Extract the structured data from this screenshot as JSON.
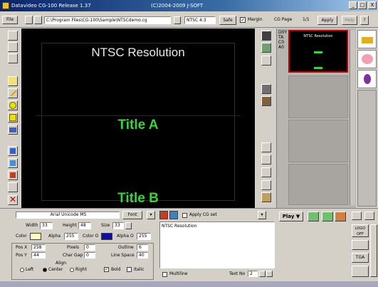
{
  "window": {
    "title": "Datavideo CG-100 Release 1.37",
    "copyright": "(C)2004-2009 J-SOFT",
    "minimize": "_",
    "maximize": "□",
    "close": "X"
  },
  "toolbar": {
    "file_label": "File",
    "path": "C:\\Program Files\\CG-100\\Sample\\NTSCdemo.cg",
    "format": "NTSC 4:3",
    "safe_label": "Safe",
    "margin_label": "Margin",
    "cg_page_label": "CG Page",
    "page_count": "1/1",
    "apply_label": "Apply",
    "help_label": "Help"
  },
  "preview": {
    "line1": "NTSC Resolution",
    "line2": "Title A",
    "line3": "Title B"
  },
  "pages": [
    {
      "label": "NTSC Resolution",
      "selected": true
    }
  ],
  "side_labels": [
    "D0Y",
    "TA",
    "C0",
    "A0"
  ],
  "bottom": {
    "font_name": "Arial Unicode MS",
    "font_btn": "Font",
    "width_label": "Width",
    "width_val": "33",
    "height_label": "Height",
    "height_val": "48",
    "size_label": "Size",
    "size_val": "33",
    "color_label": "Color",
    "alpha_label": "Alpha",
    "alpha_val": "255",
    "color2_label": "Color O",
    "alpha2_label": "Alpha O",
    "alpha2_val": "255",
    "posx_label": "Pos X",
    "posx_val": "258",
    "pixels_label": "Pixels",
    "pixels_val": "0",
    "outline_label": "Outline",
    "outline_val": "6",
    "posy_label": "Pos Y",
    "posy_val": "44",
    "chargap_label": "Char Gap",
    "chargap_val": "0",
    "linespace_label": "Line Space",
    "linespace_val": "40",
    "align_label": "Align",
    "left_label": "Left",
    "center_label": "Center",
    "right_label": "Right",
    "bold_label": "Bold",
    "italic_label": "Italic",
    "apply_cg_label": "Apply CG set",
    "text_content": "NTSC Resolution",
    "multiline_label": "Multiline",
    "textnum_label": "Text No",
    "textnum_val": "2",
    "play_label": "Play",
    "logo_label": "LOGO OFF",
    "tga_label": "TGA"
  },
  "colors": {
    "title_blue": "#0a246a",
    "accent_green": "#3cd23c",
    "page_border": "#c00000"
  }
}
